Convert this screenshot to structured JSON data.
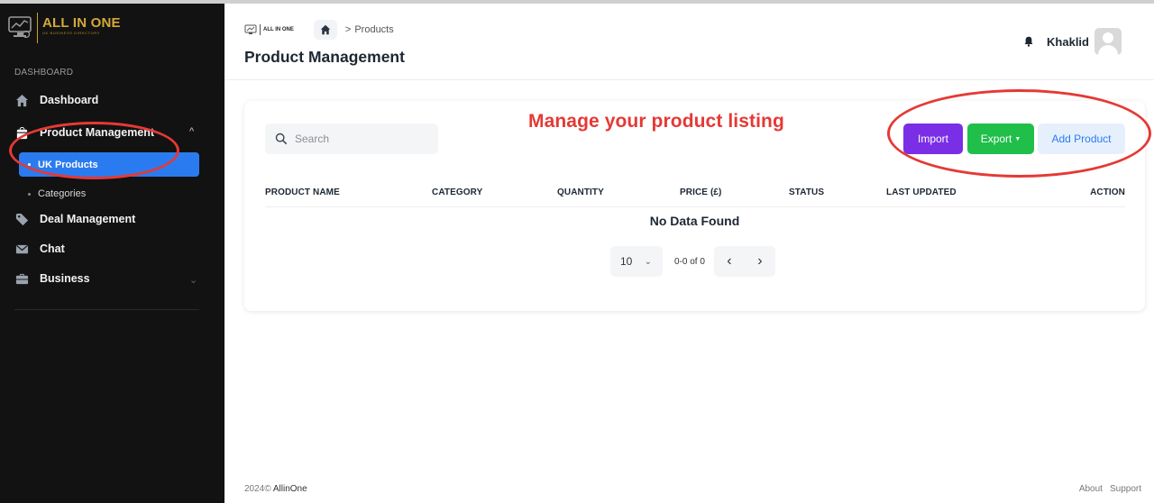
{
  "brand": {
    "name": "ALL IN ONE",
    "tagline": "UK BUSINESS DIRECTORY",
    "accent": "#d4a93a"
  },
  "sidebar": {
    "section_label": "DASHBOARD",
    "items": [
      {
        "label": "Dashboard",
        "icon": "home-icon"
      },
      {
        "label": "Product Management",
        "icon": "bag-icon",
        "expanded": true
      },
      {
        "label": "Deal Management",
        "icon": "tag-icon"
      },
      {
        "label": "Chat",
        "icon": "mail-icon"
      },
      {
        "label": "Business",
        "icon": "briefcase-icon",
        "expanded": false
      }
    ],
    "sub_items": [
      {
        "label": "UK Products",
        "active": true
      },
      {
        "label": "Categories",
        "active": false
      }
    ],
    "active_color": "#2b7bf0"
  },
  "header": {
    "breadcrumb": {
      "logo_text": "ALL IN ONE",
      "separator": ">",
      "current": "Products"
    },
    "title": "Product Management",
    "user_name": "Khaklid"
  },
  "annotation": {
    "text": "Manage your product listing",
    "color": "#e53935"
  },
  "toolbar": {
    "search_placeholder": "Search",
    "import_label": "Import",
    "export_label": "Export",
    "add_label": "Add Product",
    "colors": {
      "import": "#7a2ee6",
      "export": "#1fbf4a",
      "add_bg": "#e6f0fd"
    }
  },
  "table": {
    "columns": [
      "PRODUCT NAME",
      "CATEGORY",
      "QUANTITY",
      "PRICE (£)",
      "STATUS",
      "LAST UPDATED",
      "ACTION"
    ],
    "empty_text": "No Data Found"
  },
  "pagination": {
    "per_page": "10",
    "range": "0-0 of 0",
    "prev": "‹",
    "next": "›"
  },
  "footer": {
    "copyright_year": "2024©",
    "copyright_brand": "AllinOne",
    "links": [
      "About",
      "Support"
    ]
  }
}
